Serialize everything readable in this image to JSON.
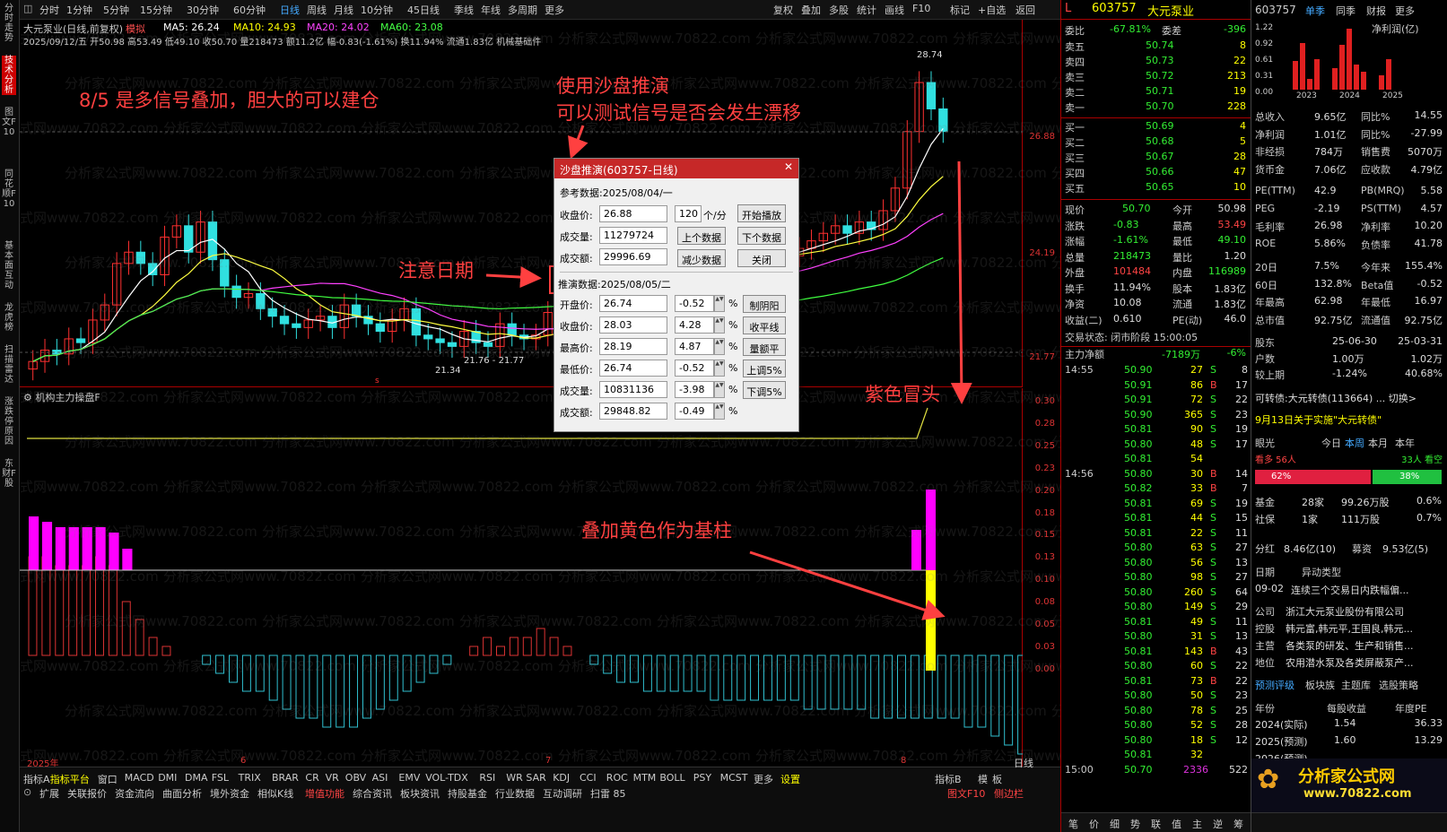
{
  "topbar": {
    "items": [
      "分时",
      "1分钟",
      "5分钟",
      "15分钟",
      "30分钟",
      "60分钟",
      "日线",
      "周线",
      "月线",
      "10分钟",
      "45日线",
      "季线",
      "年线",
      "多周期",
      "更多"
    ],
    "right": [
      "复权",
      "叠加",
      "多股",
      "统计",
      "画线",
      "F10",
      "标记",
      "+自选",
      "返回"
    ]
  },
  "vtabs": [
    "分时走势",
    "技术分析",
    "图文F10",
    "同花顺F10",
    "基本面互动",
    "龙虎榜",
    "扫描雷达",
    "涨跌停原因",
    "东财F股"
  ],
  "main": {
    "title": "大元泵业(日线,前复权)",
    "mode": "模拟",
    "ma5": "MA5: 26.24",
    "ma10": "MA10: 24.93",
    "ma20": "MA20: 24.02",
    "ma60": "MA60: 23.08",
    "ohlc": "2025/09/12/五 开50.98 高53.49 低49.10 收50.70 量218473 额11.2亿 幅-0.83(-1.61%) 换11.94% 流通1.83亿 机械基础件",
    "high_label": "28.74",
    "low_label": "21.34",
    "range_label": "21.76 - 21.77",
    "mark_s": "s"
  },
  "indicator": {
    "title": "机构主力操盘F"
  },
  "price_axis": [
    "26.88",
    "24.19",
    "21.77"
  ],
  "ind_axis": [
    "0.30",
    "0.28",
    "0.25",
    "0.23",
    "0.20",
    "0.18",
    "0.15",
    "0.13",
    "0.10",
    "0.08",
    "0.05",
    "0.03",
    "0.00"
  ],
  "months": [
    "2025年",
    "6",
    "7",
    "8"
  ],
  "annotations": {
    "n1": "8/5 是多信号叠加，胆大的可以建仓",
    "n2": "使用沙盘推演",
    "n3": "可以测试信号是否会发生漂移",
    "n4": "注意日期",
    "n5": "紫色冒头",
    "n6": "叠加黄色作为基柱"
  },
  "dialog": {
    "title": "沙盘推演(603757-日线)",
    "ref_date": "参考数据:2025/08/04/一",
    "close_label": "收盘价:",
    "close_val": "26.88",
    "speed": "120",
    "speed_unit": "个/分",
    "vol_label": "成交量:",
    "vol_val": "11279724",
    "amt_label": "成交额:",
    "amt_val": "29996.69",
    "btn_start": "开始播放",
    "btn_prev": "上个数据",
    "btn_next": "下个数据",
    "btn_less": "减少数据",
    "btn_close": "关闭",
    "deduce_date": "推演数据:2025/08/05/二",
    "rows": [
      {
        "label": "开盘价:",
        "val": "26.74",
        "pct": "-0.52",
        "btn": "制阴阳"
      },
      {
        "label": "收盘价:",
        "val": "28.03",
        "pct": "4.28",
        "btn": "收平线"
      },
      {
        "label": "最高价:",
        "val": "28.19",
        "pct": "4.87",
        "btn": "量额平"
      },
      {
        "label": "最低价:",
        "val": "26.74",
        "pct": "-0.52",
        "btn": "上调5%"
      },
      {
        "label": "成交量:",
        "val": "10831136",
        "pct": "-3.98",
        "btn": "下调5%"
      },
      {
        "label": "成交额:",
        "val": "29848.82",
        "pct": "-0.49",
        "btn": ""
      }
    ],
    "pct_sign": "%"
  },
  "bottom": {
    "row1": [
      "指标A",
      "指标平台",
      "窗口",
      "MACD",
      "DMI",
      "DMA",
      "FSL",
      "TRIX",
      "BRAR",
      "CR",
      "VR",
      "OBV",
      "ASI",
      "EMV",
      "VOL-TDX",
      "RSI",
      "WR",
      "SAR",
      "KDJ",
      "CCI",
      "ROC",
      "MTM",
      "BOLL",
      "PSY",
      "MCST",
      "更多",
      "设置"
    ],
    "row2": [
      "扩展",
      "关联报价",
      "资金流向",
      "曲面分析",
      "境外资金",
      "相似K线",
      "增值功能",
      "综合资讯",
      "板块资讯",
      "持股基金",
      "行业数据",
      "互动调研",
      "扫雷 85"
    ],
    "right1": [
      "指标B",
      "模",
      "板",
      "日线"
    ],
    "right2": [
      "图文F10",
      "侧边栏"
    ]
  },
  "quote": {
    "code": "603757",
    "name": "大元泵业",
    "webi_label": "委比",
    "webi": "-67.81%",
    "weicha_label": "委差",
    "weicha": "-396",
    "asks": [
      [
        "卖五",
        "50.74",
        "8"
      ],
      [
        "卖四",
        "50.73",
        "22"
      ],
      [
        "卖三",
        "50.72",
        "213"
      ],
      [
        "卖二",
        "50.71",
        "19"
      ],
      [
        "卖一",
        "50.70",
        "228"
      ]
    ],
    "bids": [
      [
        "买一",
        "50.69",
        "4"
      ],
      [
        "买二",
        "50.68",
        "5"
      ],
      [
        "买三",
        "50.67",
        "28"
      ],
      [
        "买四",
        "50.66",
        "47"
      ],
      [
        "买五",
        "50.65",
        "10"
      ]
    ],
    "stats": [
      [
        "现价",
        "50.70",
        "今开",
        "50.98"
      ],
      [
        "涨跌",
        "-0.83",
        "最高",
        "53.49"
      ],
      [
        "涨幅",
        "-1.61%",
        "最低",
        "49.10"
      ],
      [
        "总量",
        "218473",
        "量比",
        "1.20"
      ],
      [
        "外盘",
        "101484",
        "内盘",
        "116989"
      ],
      [
        "换手",
        "11.94%",
        "股本",
        "1.83亿"
      ],
      [
        "净资",
        "10.08",
        "流通",
        "1.83亿"
      ],
      [
        "收益(二)",
        "0.610",
        "PE(动)",
        "46.0"
      ]
    ],
    "state": "交易状态: 闭市阶段 15:00:05",
    "flow_label": "主力净额",
    "flow_val": "-7189万",
    "flow_pct": "-6%",
    "ticks": [
      [
        "14:55",
        "50.90",
        "27",
        "S",
        "8"
      ],
      [
        "",
        "50.91",
        "86",
        "B",
        "17"
      ],
      [
        "",
        "50.91",
        "72",
        "S",
        "22"
      ],
      [
        "",
        "50.90",
        "365",
        "S",
        "23"
      ],
      [
        "",
        "50.81",
        "90",
        "S",
        "19"
      ],
      [
        "",
        "50.80",
        "48",
        "S",
        "17"
      ],
      [
        "",
        "50.81",
        "54",
        "",
        ""
      ],
      [
        "14:56",
        "50.80",
        "30",
        "B",
        "14"
      ],
      [
        "",
        "50.82",
        "33",
        "B",
        "7"
      ],
      [
        "",
        "50.81",
        "69",
        "S",
        "19"
      ],
      [
        "",
        "50.81",
        "44",
        "S",
        "15"
      ],
      [
        "",
        "50.81",
        "22",
        "S",
        "11"
      ],
      [
        "",
        "50.80",
        "63",
        "S",
        "27"
      ],
      [
        "",
        "50.80",
        "56",
        "S",
        "13"
      ],
      [
        "",
        "50.80",
        "98",
        "S",
        "27"
      ],
      [
        "",
        "50.80",
        "260",
        "S",
        "64"
      ],
      [
        "",
        "50.80",
        "149",
        "S",
        "29"
      ],
      [
        "",
        "50.81",
        "49",
        "S",
        "11"
      ],
      [
        "",
        "50.80",
        "31",
        "S",
        "13"
      ],
      [
        "",
        "50.81",
        "143",
        "B",
        "43"
      ],
      [
        "",
        "50.80",
        "60",
        "S",
        "22"
      ],
      [
        "",
        "50.81",
        "73",
        "B",
        "22"
      ],
      [
        "",
        "50.80",
        "50",
        "S",
        "23"
      ],
      [
        "",
        "50.80",
        "78",
        "S",
        "25"
      ],
      [
        "",
        "50.80",
        "52",
        "S",
        "28"
      ],
      [
        "",
        "50.80",
        "18",
        "S",
        "12"
      ],
      [
        "",
        "50.81",
        "32",
        "",
        ""
      ],
      [
        "15:00",
        "50.70",
        "2336",
        "",
        "522"
      ]
    ]
  },
  "f10": {
    "code": "603757",
    "tabs": [
      "单季",
      "同季",
      "财报",
      "更多"
    ],
    "chart_title": "净利润(亿)",
    "y_labels": [
      "1.22",
      "0.92",
      "0.61",
      "0.31",
      "0.00"
    ],
    "years": [
      "2023",
      "2024",
      "2025"
    ],
    "fin": [
      [
        "总收入",
        "9.65亿",
        "同比%",
        "14.55"
      ],
      [
        "净利润",
        "1.01亿",
        "同比%",
        "-27.99"
      ],
      [
        "非经损",
        "784万",
        "销售费",
        "5070万"
      ],
      [
        "货币金",
        "7.06亿",
        "应收款",
        "4.79亿"
      ]
    ],
    "val": [
      [
        "PE(TTM)",
        "42.9",
        "PB(MRQ)",
        "5.58"
      ],
      [
        "PEG",
        "-2.19",
        "PS(TTM)",
        "4.57"
      ],
      [
        "毛利率",
        "26.98",
        "净利率",
        "10.20"
      ],
      [
        "ROE",
        "5.86%",
        "负债率",
        "41.78"
      ]
    ],
    "perf": [
      [
        "20日",
        "7.5%",
        "今年来",
        "155.4%"
      ],
      [
        "60日",
        "132.8%",
        "Beta值",
        "-0.52"
      ],
      [
        "年最高",
        "62.98",
        "年最低",
        "16.97"
      ],
      [
        "总市值",
        "92.75亿",
        "流通值",
        "92.75亿"
      ]
    ],
    "holder": [
      [
        "股东",
        "25-06-30",
        "25-03-31"
      ],
      [
        "户数",
        "1.00万",
        "1.02万"
      ],
      [
        "较上期",
        "-1.24%",
        "40.68%"
      ]
    ],
    "bond": "可转债:大元转债(113664) ... 切换>",
    "news": "9月13日关于实施\"大元转债\"",
    "eye": {
      "label": "眼光",
      "tabs": [
        "今日",
        "本周",
        "本月",
        "本年"
      ],
      "bull": "看多 56人",
      "bear": "33人 看空",
      "bull_pct": "62%",
      "bear_pct": "38%"
    },
    "funds": [
      [
        "基金",
        "28家",
        "99.26万股",
        "0.6%"
      ],
      [
        "社保",
        "1家",
        "111万股",
        "0.7%"
      ]
    ],
    "fenhong": [
      "分红",
      "8.46亿(10)",
      "募资",
      "9.53亿(5)"
    ],
    "event": [
      "日期",
      "异动类型",
      "09-02",
      "连续三个交易日内跌幅偏..."
    ],
    "company": [
      [
        "公司",
        "浙江大元泵业股份有限公司"
      ],
      [
        "控股",
        "韩元富,韩元平,王国良,韩元..."
      ],
      [
        "主营",
        "各类泵的研发、生产和销售..."
      ],
      [
        "地位",
        "农用潜水泵及各类屏蔽泵产..."
      ]
    ],
    "rate_tabs": [
      "预测评级",
      "板块族",
      "主题库",
      "选股策略"
    ],
    "forecast_hdr": [
      "年份",
      "每股收益",
      "年度PE"
    ],
    "forecast": [
      [
        "2024(实际)",
        "1.54",
        "36.33"
      ],
      [
        "2025(预测)",
        "1.60",
        "13.29"
      ],
      [
        "2026(预测)",
        "",
        ""
      ]
    ],
    "bottom_tabs": [
      "笔",
      "价",
      "细",
      "势",
      "联",
      "值",
      "主",
      "逆",
      "筹"
    ],
    "logo": "分析家公式网",
    "logo_url": "www.70822.com"
  },
  "watermark": "分析家公式网www.70822.com",
  "colors": {
    "up": "#ff3030",
    "down": "#30e0e0",
    "ma5": "#ffffff",
    "ma10": "#ffff40",
    "ma20": "#ff40ff",
    "ma60": "#40ff40",
    "magenta": "#ff00ff",
    "yellow": "#ffff00",
    "axis": "#d33"
  }
}
